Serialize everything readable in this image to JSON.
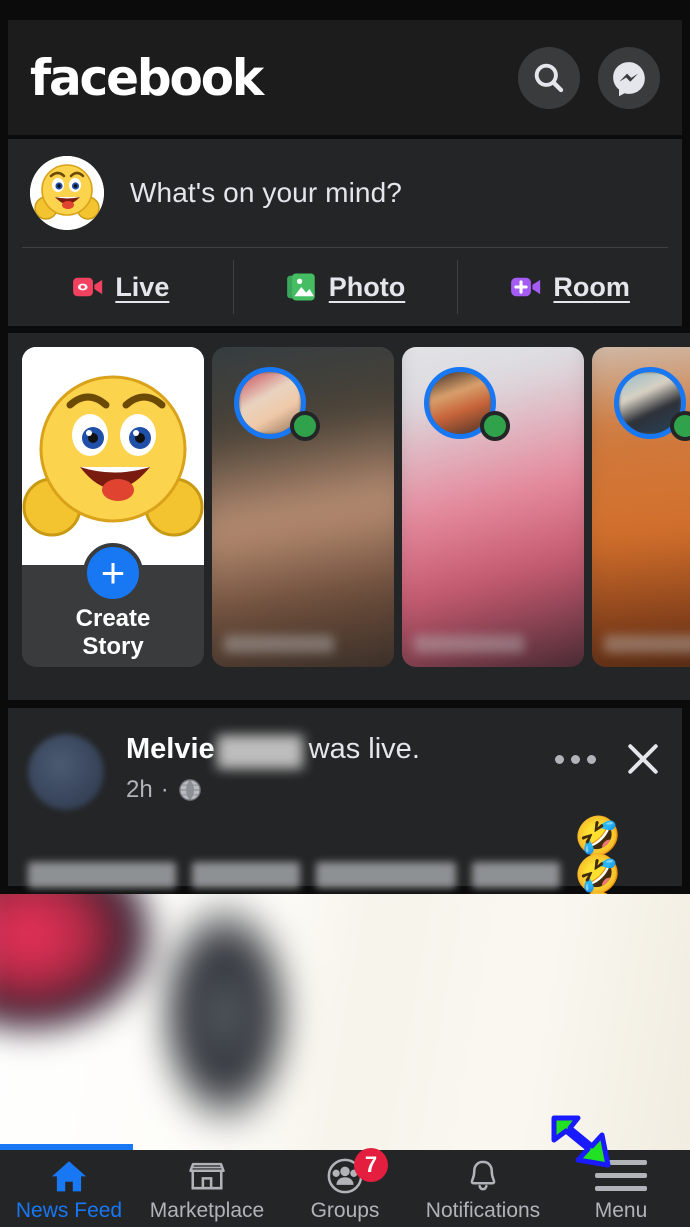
{
  "app": {
    "name": "Facebook",
    "logo_text": "facebook"
  },
  "header": {
    "logo": "facebook",
    "search_icon": "search-icon",
    "messenger_icon": "messenger-icon"
  },
  "composer": {
    "placeholder": "What's on your mind?",
    "avatar": "smiley-thumbs-up-avatar",
    "actions": [
      {
        "label": "Live",
        "icon": "live-video-icon",
        "color": "#f3425f"
      },
      {
        "label": "Photo",
        "icon": "photo-gallery-icon",
        "color": "#45bd62"
      },
      {
        "label": "Room",
        "icon": "room-video-icon",
        "color": "#a45cf5"
      }
    ]
  },
  "stories": {
    "create": {
      "label_line1": "Create",
      "label_line2": "Story",
      "plus_icon": "plus-icon"
    },
    "items": [
      {
        "name": "",
        "online": true,
        "ring_color": "#1877f2",
        "dot_color": "#31a24c"
      },
      {
        "name": "",
        "online": true,
        "ring_color": "#1877f2",
        "dot_color": "#31a24c"
      },
      {
        "name": "",
        "online": true,
        "ring_color": "#1877f2",
        "dot_color": "#31a24c"
      }
    ]
  },
  "post": {
    "author_name": "Melvie",
    "author_name_redacted": true,
    "title_suffix": "was live.",
    "timestamp": "2h",
    "separator": "·",
    "privacy_icon": "globe-icon",
    "menu_icon": "more-options-icon",
    "close_icon": "close-icon",
    "caption_redacted": true,
    "caption_emojis": "🤣🤣🤣"
  },
  "bottom_nav": {
    "items": [
      {
        "label": "News Feed",
        "icon": "home-icon",
        "active": true,
        "badge": null
      },
      {
        "label": "Marketplace",
        "icon": "marketplace-icon",
        "active": false,
        "badge": null
      },
      {
        "label": "Groups",
        "icon": "groups-icon",
        "active": false,
        "badge": "7"
      },
      {
        "label": "Notifications",
        "icon": "bell-icon",
        "active": false,
        "badge": null
      },
      {
        "label": "Menu",
        "icon": "hamburger-menu-icon",
        "active": false,
        "badge": null
      }
    ],
    "active_color": "#1877f2",
    "inactive_color": "#b0b3b8",
    "badge_color": "#e41e3f"
  },
  "annotation": {
    "type": "arrow",
    "points_to": "Menu",
    "fill_color": "#22e022",
    "outline_color": "#1a1aff"
  }
}
